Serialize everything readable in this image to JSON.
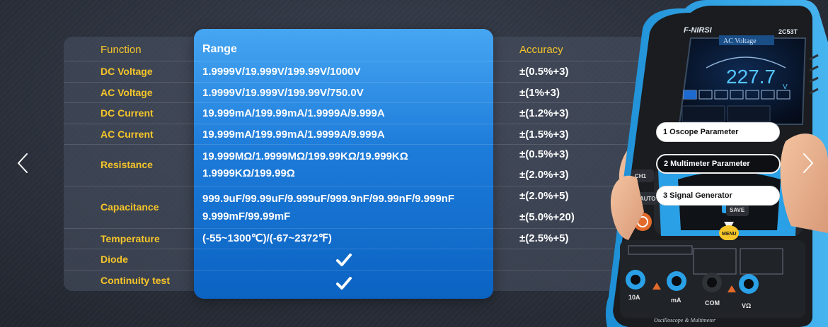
{
  "table": {
    "headers": {
      "function": "Function",
      "range": "Range",
      "accuracy": "Accuracy"
    },
    "rows": [
      {
        "function": "DC Voltage",
        "range": [
          "1.9999V/19.999V/199.99V/1000V"
        ],
        "accuracy": [
          "±(0.5%+3)"
        ]
      },
      {
        "function": "AC Voltage",
        "range": [
          "1.9999V/19.999V/199.99V/750.0V"
        ],
        "accuracy": [
          "±(1%+3)"
        ]
      },
      {
        "function": "DC Current",
        "range": [
          "19.999mA/199.99mA/1.9999A/9.999A"
        ],
        "accuracy": [
          "±(1.2%+3)"
        ]
      },
      {
        "function": "AC Current",
        "range": [
          "19.999mA/199.99mA/1.9999A/9.999A"
        ],
        "accuracy": [
          "±(1.5%+3)"
        ]
      },
      {
        "function": "Resistance",
        "range": [
          "19.999MΩ/1.9999MΩ/199.99KΩ/19.999KΩ",
          "1.9999KΩ/199.99Ω"
        ],
        "accuracy": [
          "±(0.5%+3)",
          "±(2.0%+3)"
        ]
      },
      {
        "function": "Capacitance",
        "range": [
          "999.9uF/99.99uF/9.999uF/999.9nF/99.99nF/9.999nF",
          "9.999mF/99.99mF"
        ],
        "accuracy": [
          "±(2.0%+5)",
          "±(5.0%+20)"
        ]
      },
      {
        "function": "Temperature",
        "range": [
          "(-55~1300℃)/(-67~2372℉)"
        ],
        "accuracy": [
          "±(2.5%+5)"
        ]
      },
      {
        "function": "Diode",
        "range": [],
        "check": true,
        "accuracy": []
      },
      {
        "function": "Continuity test",
        "range": [],
        "check": true,
        "accuracy": []
      }
    ]
  },
  "device": {
    "brand": "FNIRSI",
    "model": "2C53T",
    "screen_mode": "AC Voltage",
    "reading": "227.7",
    "unit": "V",
    "port_labels": [
      "10A",
      "mA",
      "COM",
      "VΩ"
    ],
    "footer": "Oscilloscope & Multimeter",
    "buttons": [
      "AUTO",
      "SAVE",
      "MENU",
      "CH1"
    ]
  },
  "menu": [
    {
      "label": "1  Oscope Parameter",
      "active": false
    },
    {
      "label": "2  Multimeter Parameter",
      "active": true
    },
    {
      "label": "3  Signal Generator",
      "active": false
    }
  ],
  "colors": {
    "accent_yellow": "#f6c52a",
    "range_blue": "#1d7bd9",
    "device_blue": "#2aa3e6"
  },
  "icons": {
    "prev": "chevron-left-icon",
    "next": "chevron-right-icon",
    "check": "checkmark-icon"
  }
}
